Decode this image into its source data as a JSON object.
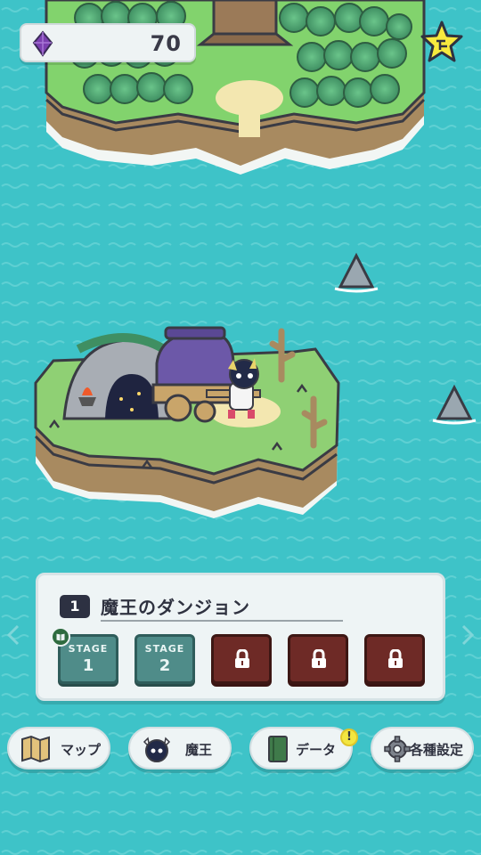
{
  "hud": {
    "gems": "70",
    "gem_icon": "purple-gem-icon",
    "favorite_icon": "star-icon"
  },
  "stage_panel": {
    "number": "1",
    "title": "魔王のダンジョン",
    "stages": [
      {
        "label": "STAGE",
        "number": "1",
        "locked": false
      },
      {
        "label": "STAGE",
        "number": "2",
        "locked": false
      },
      {
        "locked": true
      },
      {
        "locked": true
      },
      {
        "locked": true
      }
    ]
  },
  "nav": {
    "map": "マップ",
    "demon_king": "魔王",
    "data": "データ",
    "data_alert": "!",
    "settings": "各種設定"
  },
  "colors": {
    "sea": "#3ec3c8",
    "grass": "#7fcf6a",
    "cliff": "#a88a60",
    "stage_unlocked": "#4f8c89",
    "stage_locked": "#6e2a26",
    "gem": "#7b3fb0"
  }
}
